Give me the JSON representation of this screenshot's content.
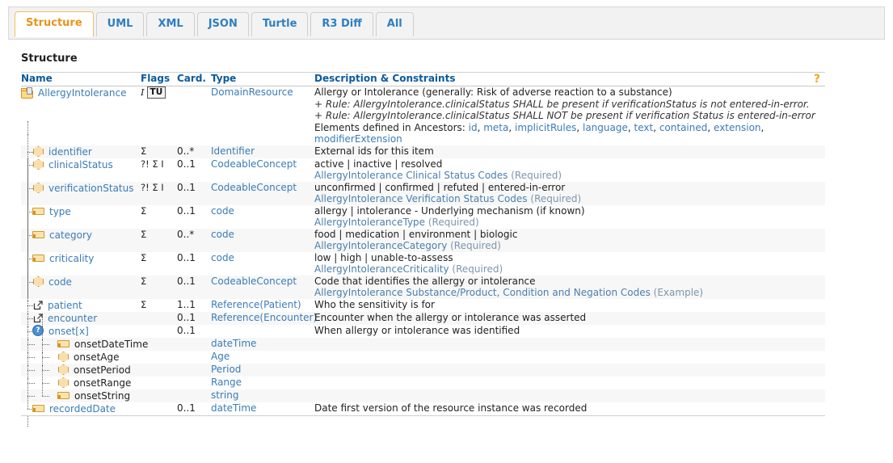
{
  "tabs": [
    {
      "label": "Structure",
      "active": true
    },
    {
      "label": "UML",
      "active": false
    },
    {
      "label": "XML",
      "active": false
    },
    {
      "label": "JSON",
      "active": false
    },
    {
      "label": "Turtle",
      "active": false
    },
    {
      "label": "R3 Diff",
      "active": false
    },
    {
      "label": "All",
      "active": false
    }
  ],
  "section": {
    "title": "Structure"
  },
  "table": {
    "headers": {
      "name": "Name",
      "flags": "Flags",
      "card": "Card.",
      "type": "Type",
      "desc": "Description & Constraints",
      "help_icon": "?"
    },
    "rows": [
      {
        "name": "AllergyIntolerance",
        "icon": "folder-icon",
        "indent": 0,
        "flags": "I",
        "badge": "TU",
        "card": "",
        "type": "DomainResource",
        "desc_line1": "Allergy or Intolerance (generally: Risk of adverse reaction to a substance)",
        "rule1": "+ Rule: AllergyIntolerance.clinicalStatus SHALL be present if verificationStatus is not entered-in-error.",
        "rule2": "+ Rule: AllergyIntolerance.clinicalStatus SHALL NOT be present if verification Status is entered-in-error",
        "ancestors_label": "Elements defined in Ancestors:",
        "ancestors": [
          "id",
          "meta",
          "implicitRules",
          "language",
          "text",
          "contained",
          "extension",
          "modifierExtension"
        ]
      },
      {
        "name": "identifier",
        "icon": "datatype-icon",
        "indent": 1,
        "flags": "Σ",
        "card": "0..*",
        "type": "Identifier",
        "desc_line1": "External ids for this item",
        "binding": "",
        "binding_strength": ""
      },
      {
        "name": "clinicalStatus",
        "icon": "datatype-icon",
        "indent": 1,
        "flags": "?! Σ I",
        "card": "0..1",
        "type": "CodeableConcept",
        "desc_line1": "active | inactive | resolved",
        "binding": "AllergyIntolerance Clinical Status Codes",
        "binding_strength": "(Required)"
      },
      {
        "name": "verificationStatus",
        "icon": "datatype-icon",
        "indent": 1,
        "flags": "?! Σ I",
        "card": "0..1",
        "type": "CodeableConcept",
        "desc_line1": "unconfirmed | confirmed | refuted | entered-in-error",
        "binding": "AllergyIntolerance Verification Status Codes",
        "binding_strength": "(Required)"
      },
      {
        "name": "type",
        "icon": "primitive-icon",
        "indent": 1,
        "flags": "Σ",
        "card": "0..1",
        "type": "code",
        "desc_line1": "allergy | intolerance - Underlying mechanism (if known)",
        "binding": "AllergyIntoleranceType",
        "binding_strength": "(Required)"
      },
      {
        "name": "category",
        "icon": "primitive-icon",
        "indent": 1,
        "flags": "Σ",
        "card": "0..*",
        "type": "code",
        "desc_line1": "food | medication | environment | biologic",
        "binding": "AllergyIntoleranceCategory",
        "binding_strength": "(Required)"
      },
      {
        "name": "criticality",
        "icon": "primitive-icon",
        "indent": 1,
        "flags": "Σ",
        "card": "0..1",
        "type": "code",
        "desc_line1": "low | high | unable-to-assess",
        "binding": "AllergyIntoleranceCriticality",
        "binding_strength": "(Required)"
      },
      {
        "name": "code",
        "icon": "datatype-icon",
        "indent": 1,
        "flags": "Σ",
        "card": "0..1",
        "type": "CodeableConcept",
        "desc_line1": "Code that identifies the allergy or intolerance",
        "binding": "AllergyIntolerance Substance/Product, Condition and Negation Codes",
        "binding_strength": "(Example)"
      },
      {
        "name": "patient",
        "icon": "reference-icon",
        "indent": 1,
        "flags": "Σ",
        "card": "1..1",
        "type": "Reference(Patient)",
        "desc_line1": "Who the sensitivity is for",
        "binding": "",
        "binding_strength": ""
      },
      {
        "name": "encounter",
        "icon": "reference-icon",
        "indent": 1,
        "flags": "",
        "card": "0..1",
        "type": "Reference(Encounter)",
        "desc_line1": "Encounter when the allergy or intolerance was asserted",
        "binding": "",
        "binding_strength": ""
      },
      {
        "name": "onset[x]",
        "icon": "choice-icon",
        "indent": 1,
        "flags": "",
        "card": "0..1",
        "type": "",
        "desc_line1": "When allergy or intolerance was identified",
        "binding": "",
        "binding_strength": ""
      },
      {
        "name": "onsetDateTime",
        "icon": "primitive-icon",
        "indent": 2,
        "flags": "",
        "card": "",
        "type": "dateTime",
        "desc_line1": "",
        "binding": "",
        "binding_strength": "",
        "plain_name": true
      },
      {
        "name": "onsetAge",
        "icon": "datatype-icon",
        "indent": 2,
        "flags": "",
        "card": "",
        "type": "Age",
        "desc_line1": "",
        "binding": "",
        "binding_strength": "",
        "plain_name": true
      },
      {
        "name": "onsetPeriod",
        "icon": "datatype-icon",
        "indent": 2,
        "flags": "",
        "card": "",
        "type": "Period",
        "desc_line1": "",
        "binding": "",
        "binding_strength": "",
        "plain_name": true
      },
      {
        "name": "onsetRange",
        "icon": "datatype-icon",
        "indent": 2,
        "flags": "",
        "card": "",
        "type": "Range",
        "desc_line1": "",
        "binding": "",
        "binding_strength": "",
        "plain_name": true
      },
      {
        "name": "onsetString",
        "icon": "primitive-icon",
        "indent": 2,
        "flags": "",
        "card": "",
        "type": "string",
        "desc_line1": "",
        "binding": "",
        "binding_strength": "",
        "plain_name": true
      },
      {
        "name": "recordedDate",
        "icon": "primitive-icon",
        "indent": 1,
        "flags": "",
        "card": "0..1",
        "type": "dateTime",
        "desc_line1": "Date first version of the resource instance was recorded",
        "binding": "",
        "binding_strength": ""
      }
    ]
  },
  "colors": {
    "active_tab": "#e8941a",
    "tab_link": "#2e7fc1",
    "header_text": "#0b5a9e",
    "link": "#3a7cb8",
    "binding_strength": "#7d96ad",
    "row_alt": "#f7f7f7",
    "help_icon": "#f0a81e"
  }
}
